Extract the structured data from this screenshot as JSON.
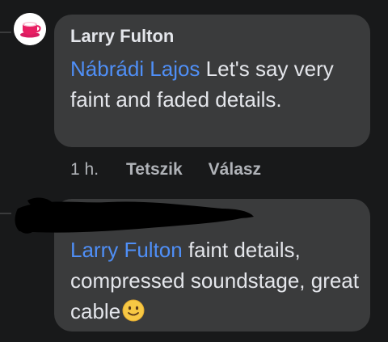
{
  "comments": [
    {
      "author": "Larry Fulton",
      "mention": "Nábrádi Lajos",
      "text": " Let's say very faint and faded details.",
      "time": "1 h.",
      "like_label": "Tetszik",
      "reply_label": "Válasz"
    },
    {
      "mention": "Larry Fulton",
      "text": " faint details, compressed soundstage, great cable",
      "emoji": "slightly-smiling-face"
    }
  ],
  "colors": {
    "background": "#18191a",
    "bubble": "#3a3b3c",
    "text": "#e4e6eb",
    "secondary_text": "#b0b3b8",
    "mention": "#4f8ff7"
  }
}
